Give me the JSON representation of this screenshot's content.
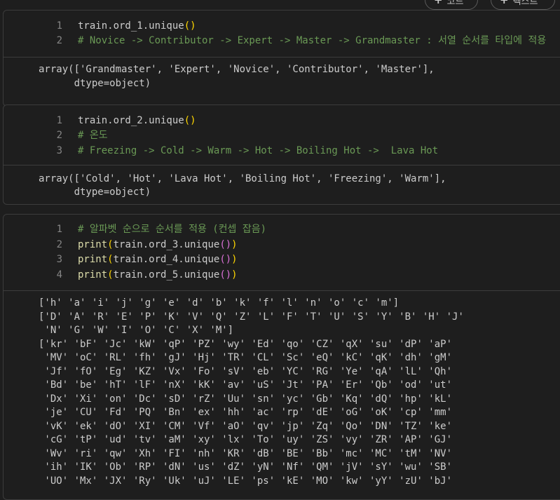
{
  "toolbar": {
    "add_code_label": "코드",
    "add_text_label": "텍스트"
  },
  "cells": [
    {
      "input": [
        {
          "n": "1",
          "text": "train.ord_1.unique()"
        },
        {
          "n": "2",
          "text": "# Novice -> Contributor -> Expert -> Master -> Grandmaster : 서열 순서를 타입에 적용"
        }
      ],
      "output": [
        "array(['Grandmaster', 'Expert', 'Novice', 'Contributor', 'Master'],",
        "      dtype=object)"
      ]
    },
    {
      "input": [
        {
          "n": "1",
          "text": "train.ord_2.unique()"
        },
        {
          "n": "2",
          "text": "# 온도"
        },
        {
          "n": "3",
          "text": "# Freezing -> Cold -> Warm -> Hot -> Boiling Hot ->  Lava Hot"
        }
      ],
      "output": [
        "array(['Cold', 'Hot', 'Lava Hot', 'Boiling Hot', 'Freezing', 'Warm'],",
        "      dtype=object)"
      ]
    },
    {
      "input": [
        {
          "n": "1",
          "text": "# 알파벳 순으로 순서를 적용 (컨셉 잡음)"
        },
        {
          "n": "2",
          "text": "print(train.ord_3.unique())"
        },
        {
          "n": "3",
          "text": "print(train.ord_4.unique())"
        },
        {
          "n": "4",
          "text": "print(train.ord_5.unique())"
        }
      ],
      "output": [
        "['h' 'a' 'i' 'j' 'g' 'e' 'd' 'b' 'k' 'f' 'l' 'n' 'o' 'c' 'm']",
        "['D' 'A' 'R' 'E' 'P' 'K' 'V' 'Q' 'Z' 'L' 'F' 'T' 'U' 'S' 'Y' 'B' 'H' 'J'",
        " 'N' 'G' 'W' 'I' 'O' 'C' 'X' 'M']",
        "['kr' 'bF' 'Jc' 'kW' 'qP' 'PZ' 'wy' 'Ed' 'qo' 'CZ' 'qX' 'su' 'dP' 'aP'",
        " 'MV' 'oC' 'RL' 'fh' 'gJ' 'Hj' 'TR' 'CL' 'Sc' 'eQ' 'kC' 'qK' 'dh' 'gM'",
        " 'Jf' 'fO' 'Eg' 'KZ' 'Vx' 'Fo' 'sV' 'eb' 'YC' 'RG' 'Ye' 'qA' 'lL' 'Qh'",
        " 'Bd' 'be' 'hT' 'lF' 'nX' 'kK' 'av' 'uS' 'Jt' 'PA' 'Er' 'Qb' 'od' 'ut'",
        " 'Dx' 'Xi' 'on' 'Dc' 'sD' 'rZ' 'Uu' 'sn' 'yc' 'Gb' 'Kq' 'dQ' 'hp' 'kL'",
        " 'je' 'CU' 'Fd' 'PQ' 'Bn' 'ex' 'hh' 'ac' 'rp' 'dE' 'oG' 'oK' 'cp' 'mm'",
        " 'vK' 'ek' 'dO' 'XI' 'CM' 'Vf' 'aO' 'qv' 'jp' 'Zq' 'Qo' 'DN' 'TZ' 'ke'",
        " 'cG' 'tP' 'ud' 'tv' 'aM' 'xy' 'lx' 'To' 'uy' 'ZS' 'vy' 'ZR' 'AP' 'GJ'",
        " 'Wv' 'ri' 'qw' 'Xh' 'FI' 'nh' 'KR' 'dB' 'BE' 'Bb' 'mc' 'MC' 'tM' 'NV'",
        " 'ih' 'IK' 'Ob' 'RP' 'dN' 'us' 'dZ' 'yN' 'Nf' 'QM' 'jV' 'sY' 'wu' 'SB'",
        " 'UO' 'Mx' 'JX' 'Ry' 'Uk' 'uJ' 'LE' 'ps' 'kE' 'MO' 'kw' 'yY' 'zU' 'bJ'"
      ]
    }
  ]
}
